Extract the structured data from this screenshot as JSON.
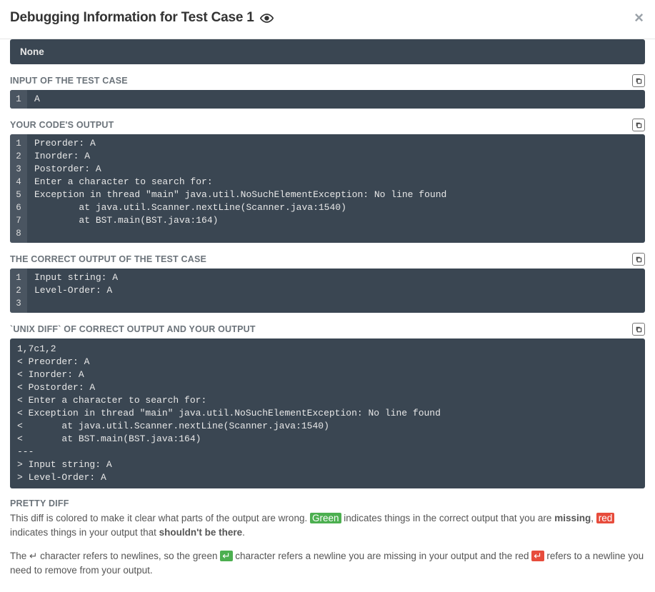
{
  "modal": {
    "title": "Debugging Information for Test Case 1"
  },
  "none_block": "None",
  "sections": {
    "input": {
      "title": "INPUT OF THE TEST CASE",
      "lines": [
        "A"
      ]
    },
    "your_output": {
      "title": "YOUR CODE'S OUTPUT",
      "lines": [
        "Preorder: A",
        "Inorder: A",
        "Postorder: A",
        "Enter a character to search for:",
        "Exception in thread \"main\" java.util.NoSuchElementException: No line found",
        "        at java.util.Scanner.nextLine(Scanner.java:1540)",
        "        at BST.main(BST.java:164)",
        ""
      ]
    },
    "correct_output": {
      "title": "THE CORRECT OUTPUT OF THE TEST CASE",
      "lines": [
        "Input string: A",
        "Level-Order: A",
        ""
      ]
    },
    "unix_diff": {
      "title": "`UNIX DIFF` OF CORRECT OUTPUT AND YOUR OUTPUT",
      "text": "1,7c1,2\n< Preorder: A\n< Inorder: A\n< Postorder: A\n< Enter a character to search for:\n< Exception in thread \"main\" java.util.NoSuchElementException: No line found\n<       at java.util.Scanner.nextLine(Scanner.java:1540)\n<       at BST.main(BST.java:164)\n---\n> Input string: A\n> Level-Order: A"
    },
    "pretty_diff": {
      "title": "PRETTY DIFF",
      "p1_a": "This diff is colored to make it clear what parts of the output are wrong. ",
      "p1_green": "Green",
      "p1_b": " indicates things in the correct output that you are ",
      "p1_missing": "missing",
      "p1_c": ", ",
      "p1_red": "red",
      "p1_d": " indicates things in your output that ",
      "p1_shouldnt": "shouldn't be there",
      "p1_e": ".",
      "p2_a": "The ↵ character refers to newlines, so the green ",
      "p2_greenchar": "↵",
      "p2_b": " character refers a newline you are missing in your output and the red ",
      "p2_redchar": "↵",
      "p2_c": " refers to a newline you need to remove from your output."
    }
  }
}
